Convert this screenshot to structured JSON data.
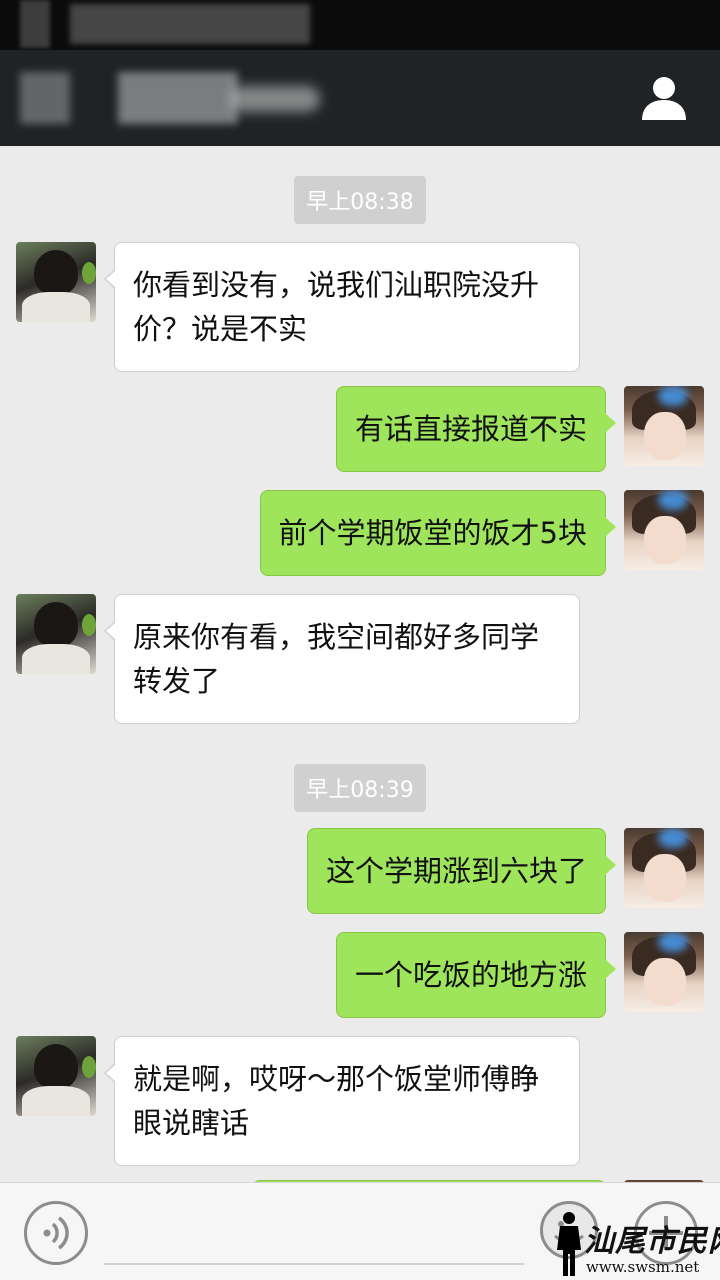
{
  "status_bar": {},
  "header": {
    "contact_icon": "person-icon"
  },
  "chat": {
    "timestamps": [
      "早上08:38",
      "早上08:39"
    ],
    "messages": [
      {
        "side": "left",
        "text": "你看到没有，说我们汕职院没升价？说是不实"
      },
      {
        "side": "right",
        "text": "有话直接报道不实"
      },
      {
        "side": "right",
        "text": "前个学期饭堂的饭才5块"
      },
      {
        "side": "left",
        "text": "原来你有看，我空间都好多同学转发了"
      },
      {
        "side": "right",
        "text": "这个学期涨到六块了"
      },
      {
        "side": "right",
        "text": "一个吃饭的地方涨"
      },
      {
        "side": "left",
        "text": "就是啊，哎呀～那个饭堂师傅睁眼说瞎话"
      }
    ]
  },
  "input_bar": {
    "voice_icon": "voice-icon",
    "emoji_icon": "emoji-icon",
    "plus_icon": "plus-icon",
    "text_value": ""
  },
  "watermark": {
    "title": "汕尾市民网",
    "url": "www.swsm.net"
  },
  "colors": {
    "chat_bg": "#ebebeb",
    "header_bg": "#1f2326",
    "sent_bubble": "#9fe55b",
    "received_bubble": "#ffffff",
    "timestamp_bg": "#d0d0d0"
  }
}
